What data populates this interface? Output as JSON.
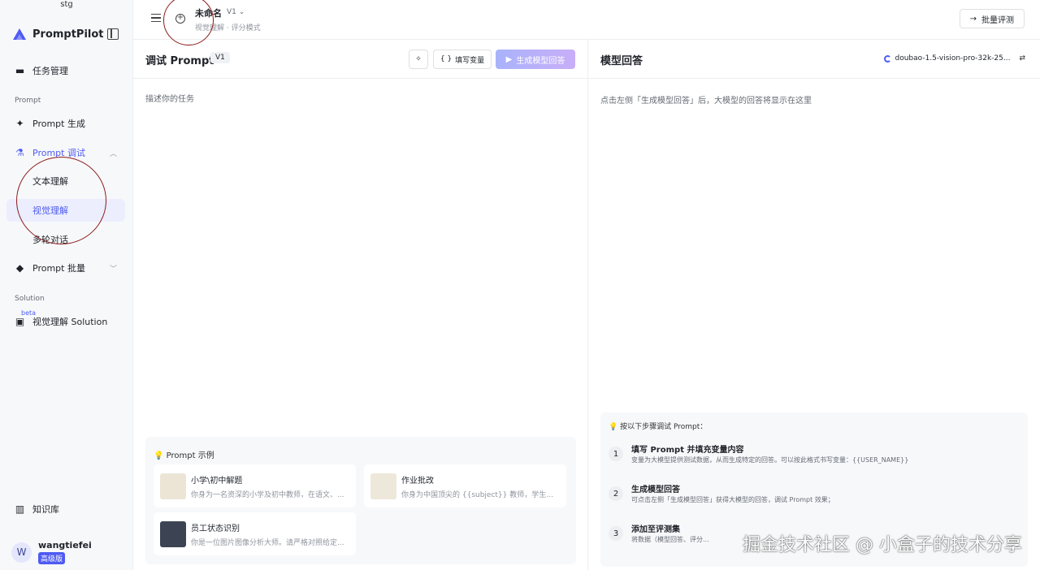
{
  "env": "stg",
  "app": {
    "name": "PromptPilot"
  },
  "sidebar": {
    "task_mgmt": "任务管理",
    "section_prompt": "Prompt",
    "prompt_gen": "Prompt 生成",
    "prompt_debug": "Prompt 调试",
    "sub_items": [
      "文本理解",
      "视觉理解",
      "多轮对话"
    ],
    "prompt_batch": "Prompt 批量",
    "section_solution": "Solution",
    "beta": "beta",
    "vision_solution": "视觉理解 Solution",
    "knowledge": "知识库"
  },
  "user": {
    "initial": "W",
    "name": "wangtiefei",
    "tier": "高级版"
  },
  "topbar": {
    "title": "未命名",
    "version": "V1",
    "mode": "视觉理解 · 评分模式",
    "batch_eval": "批量评测"
  },
  "left": {
    "title": "调试 Prompt",
    "version": "V1",
    "fill_vars": "填写变量",
    "generate": "生成模型回答",
    "task_placeholder": "描述你的任务",
    "examples_title": "Prompt 示例",
    "examples": [
      {
        "name": "小学\\初中解题",
        "desc": "你身为一名资深的小学及初中教师，在语文、..."
      },
      {
        "name": "作业批改",
        "desc": "你身为中国顶尖的 {{subject}} 教师，学生会将..."
      },
      {
        "name": "员工状态识别",
        "desc": "你是一位图片图像分析大师。请严格对照给定..."
      }
    ]
  },
  "right": {
    "title": "模型回答",
    "model": "doubao-1.5-vision-pro-32k-25...",
    "placeholder": "点击左侧「生成模型回答」后，大模型的回答将显示在这里",
    "steps_title": "按以下步骤调试 Prompt：",
    "steps": [
      {
        "num": "1",
        "title": "填写 Prompt 并填充变量内容",
        "desc": "变量为大模型提供测试数据，从而生成特定的回答。可以按此格式书写变量：{{USER_NAME}}"
      },
      {
        "num": "2",
        "title": "生成模型回答",
        "desc": "可点击左侧「生成模型回答」获得大模型的回答，调试 Prompt 效果；"
      },
      {
        "num": "3",
        "title": "添加至评测集",
        "desc": "将数据（模型回答、评分..."
      }
    ]
  },
  "watermark": "掘金技术社区 @ 小盒子的技术分享",
  "colors": {
    "accent": "#4e5bf2",
    "annotation": "#8b1a1a"
  }
}
